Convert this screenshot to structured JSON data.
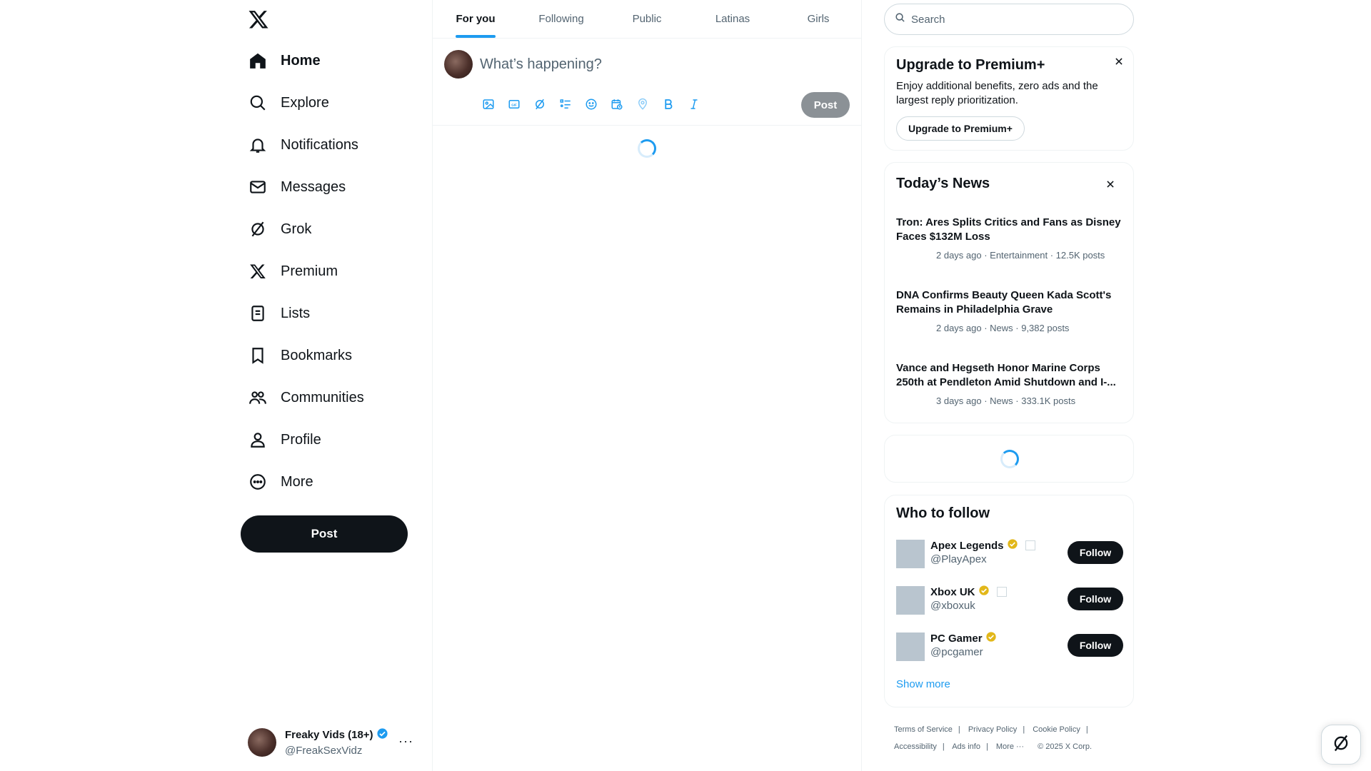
{
  "sidebar": {
    "logo": "x-logo",
    "items": [
      {
        "label": "Home",
        "icon": "home-icon"
      },
      {
        "label": "Explore",
        "icon": "search-icon"
      },
      {
        "label": "Notifications",
        "icon": "bell-icon"
      },
      {
        "label": "Messages",
        "icon": "mail-icon"
      },
      {
        "label": "Grok",
        "icon": "grok-icon"
      },
      {
        "label": "Premium",
        "icon": "x-icon"
      },
      {
        "label": "Lists",
        "icon": "list-icon"
      },
      {
        "label": "Bookmarks",
        "icon": "bookmark-icon"
      },
      {
        "label": "Communities",
        "icon": "communities-icon"
      },
      {
        "label": "Profile",
        "icon": "person-icon"
      },
      {
        "label": "More",
        "icon": "more-circle-icon"
      }
    ],
    "post_label": "Post",
    "account": {
      "name": "Freaky Vids (18+)",
      "handle": "@FreakSexVidz",
      "more": "···"
    }
  },
  "tabs": [
    {
      "label": "For you",
      "active": true
    },
    {
      "label": "Following"
    },
    {
      "label": "Public"
    },
    {
      "label": "Latinas"
    },
    {
      "label": "Girls"
    }
  ],
  "composer": {
    "placeholder": "What’s happening?",
    "post_label": "Post",
    "tools": [
      "image-icon",
      "gif-icon",
      "grok-icon",
      "poll-icon",
      "emoji-icon",
      "schedule-icon",
      "location-icon",
      "bold-icon",
      "italic-icon"
    ]
  },
  "search": {
    "placeholder": "Search"
  },
  "premium": {
    "title": "Upgrade to Premium+",
    "description": "Enjoy additional benefits, zero ads and the largest reply prioritization.",
    "button": "Upgrade to Premium+"
  },
  "news": {
    "title": "Today’s News",
    "items": [
      {
        "headline": "Tron: Ares Splits Critics and Fans as Disney Faces $132M Loss",
        "meta": "2 days ago · Entertainment · 12.5K posts"
      },
      {
        "headline": "DNA Confirms Beauty Queen Kada Scott's Remains in Philadelphia Grave",
        "meta": "2 days ago · News · 9,382 posts"
      },
      {
        "headline": "Vance and Hegseth Honor Marine Corps 250th at Pendleton Amid Shutdown and I-...",
        "meta": "3 days ago · News · 333.1K posts"
      }
    ]
  },
  "who_to_follow": {
    "title": "Who to follow",
    "users": [
      {
        "name": "Apex Legends",
        "handle": "@PlayApex",
        "button": "Follow"
      },
      {
        "name": "Xbox UK",
        "handle": "@xboxuk",
        "button": "Follow"
      },
      {
        "name": "PC Gamer",
        "handle": "@pcgamer",
        "button": "Follow"
      }
    ],
    "show_more": "Show more"
  },
  "footer": {
    "links": [
      "Terms of Service",
      "Privacy Policy",
      "Cookie Policy",
      "Accessibility",
      "Ads info",
      "More ···"
    ],
    "copyright": "© 2025 X Corp."
  },
  "colors": {
    "accent": "#1d9bf0",
    "text": "#0f1419",
    "muted": "#536471",
    "verified_gold": "#e2b719"
  }
}
